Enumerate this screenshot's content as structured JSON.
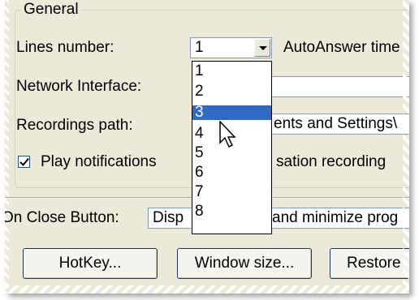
{
  "group": {
    "title": "General"
  },
  "lines": {
    "label": "Lines number:",
    "value": "1",
    "autoanswer_label": "AutoAnswer time"
  },
  "network": {
    "label": "Network Interface:"
  },
  "recordings": {
    "label": "Recordings path:",
    "path_fragment": "ents and Settings\\"
  },
  "notify": {
    "label_left": "Play notifications",
    "label_right": "sation recording",
    "checked": true
  },
  "onclose": {
    "label": "On Close Button:",
    "value_left": "Disp",
    "value_right": "and minimize prog"
  },
  "buttons": {
    "hotkey": "HotKey...",
    "window_size": "Window size...",
    "restore": "Restore"
  },
  "dropdown": {
    "options": [
      "1",
      "2",
      "3",
      "4",
      "5",
      "6",
      "7",
      "8"
    ],
    "selected": "3"
  }
}
